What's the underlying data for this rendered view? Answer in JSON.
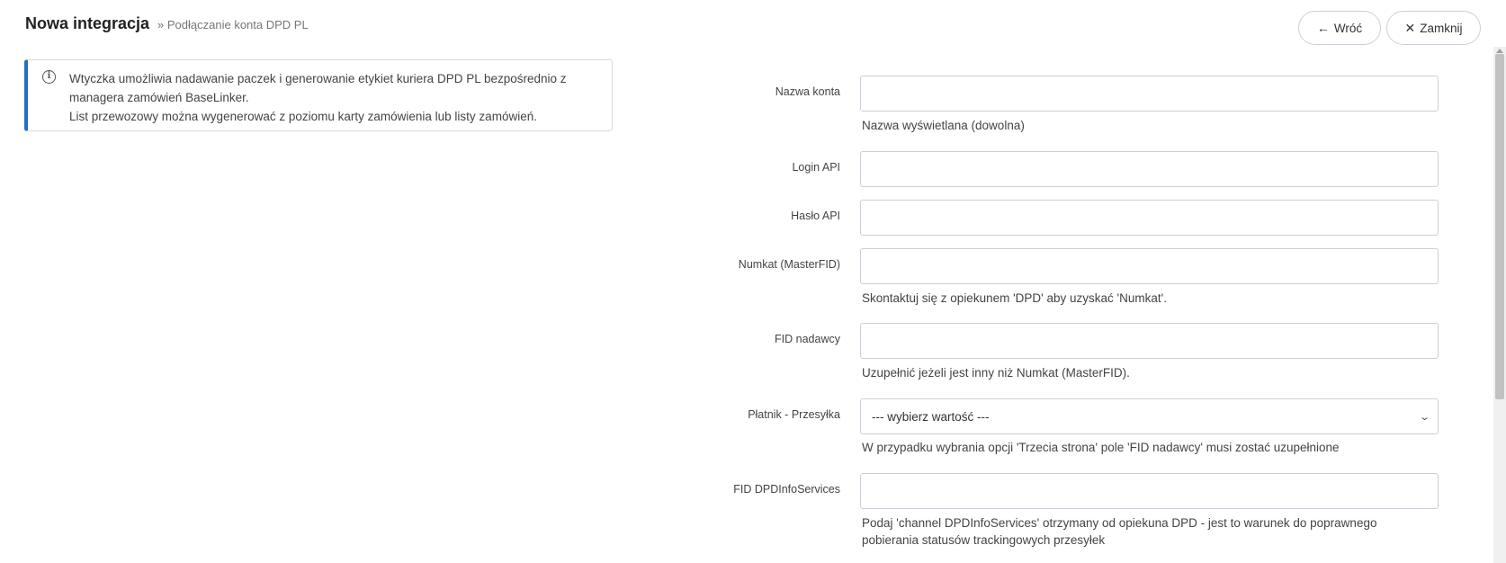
{
  "header": {
    "title": "Nowa integracja",
    "breadcrumb": "» Podłączanie konta DPD PL",
    "back_label": "Wróć",
    "back_icon": "arrow-left-icon",
    "close_label": "Zamknij",
    "close_icon": "close-icon"
  },
  "info": {
    "icon": "info-icon",
    "line1": "Wtyczka umożliwia nadawanie paczek i generowanie etykiet kuriera DPD PL bezpośrednio z",
    "line2": "managera zamówień BaseLinker.",
    "line3": "List przewozowy można wygenerować z poziomu karty zamówienia lub listy zamówień."
  },
  "form": {
    "account_name": {
      "label": "Nazwa konta",
      "value": "",
      "help": "Nazwa wyświetlana (dowolna)"
    },
    "api_login": {
      "label": "Login API",
      "value": ""
    },
    "api_password": {
      "label": "Hasło API",
      "value": ""
    },
    "numkat": {
      "label": "Numkat (MasterFID)",
      "value": "",
      "help": "Skontaktuj się z opiekunem 'DPD' aby uzyskać 'Numkat'."
    },
    "fid_sender": {
      "label": "FID nadawcy",
      "value": "",
      "help": "Uzupełnić jeżeli jest inny niż Numkat (MasterFID)."
    },
    "payer": {
      "label": "Płatnik - Przesyłka",
      "selected": "--- wybierz wartość ---",
      "help": "W przypadku wybrania opcji 'Trzecia strona' pole 'FID nadawcy' musi zostać uzupełnione"
    },
    "fid_infoservices": {
      "label": "FID DPDInfoServices",
      "value": "",
      "help_line1": "Podaj 'channel DPDInfoServices' otrzymany od opiekuna DPD - jest to warunek do poprawnego",
      "help_line2": "pobierania statusów trackingowych przesyłek"
    }
  }
}
